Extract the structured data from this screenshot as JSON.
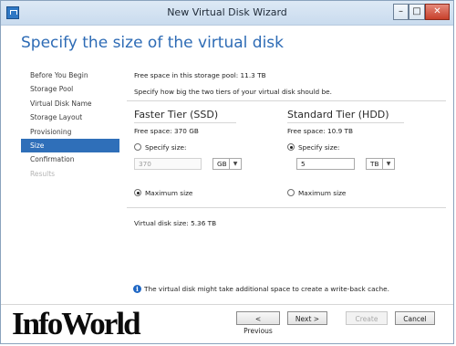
{
  "window": {
    "title": "New Virtual Disk Wizard",
    "minimize_glyph": "–",
    "maximize_glyph": "□",
    "close_glyph": "✕"
  },
  "heading": "Specify the size of the virtual disk",
  "nav": {
    "items": [
      {
        "label": "Before You Begin",
        "state": "normal"
      },
      {
        "label": "Storage Pool",
        "state": "normal"
      },
      {
        "label": "Virtual Disk Name",
        "state": "normal"
      },
      {
        "label": "Storage Layout",
        "state": "normal"
      },
      {
        "label": "Provisioning",
        "state": "normal"
      },
      {
        "label": "Size",
        "state": "active"
      },
      {
        "label": "Confirmation",
        "state": "normal"
      },
      {
        "label": "Results",
        "state": "disabled"
      }
    ]
  },
  "main": {
    "free_space_pool": "Free space in this storage pool: 11.3 TB",
    "instruction": "Specify how big the two tiers of your virtual disk should be.",
    "faster_tier": {
      "title": "Faster Tier (SSD)",
      "free_space": "Free space: 370 GB",
      "specify_label": "Specify size:",
      "specify_selected": false,
      "size_value": "370",
      "unit": "GB",
      "maximum_label": "Maximum size",
      "maximum_selected": true
    },
    "standard_tier": {
      "title": "Standard Tier (HDD)",
      "free_space": "Free space: 10.9 TB",
      "specify_label": "Specify size:",
      "specify_selected": true,
      "size_value": "5",
      "unit": "TB",
      "maximum_label": "Maximum size",
      "maximum_selected": false
    },
    "virtual_disk_size": "Virtual disk size: 5.36 TB",
    "info_glyph": "i",
    "info_note": "The virtual disk might take additional space to create a write-back cache."
  },
  "footer": {
    "previous_label": "< Previous",
    "next_label": "Next >",
    "create_label": "Create",
    "cancel_label": "Cancel"
  },
  "watermark": "InfoWorld",
  "colors": {
    "accent": "#2f6fb9",
    "heading": "#2d6bb5",
    "info": "#1f67c4"
  }
}
